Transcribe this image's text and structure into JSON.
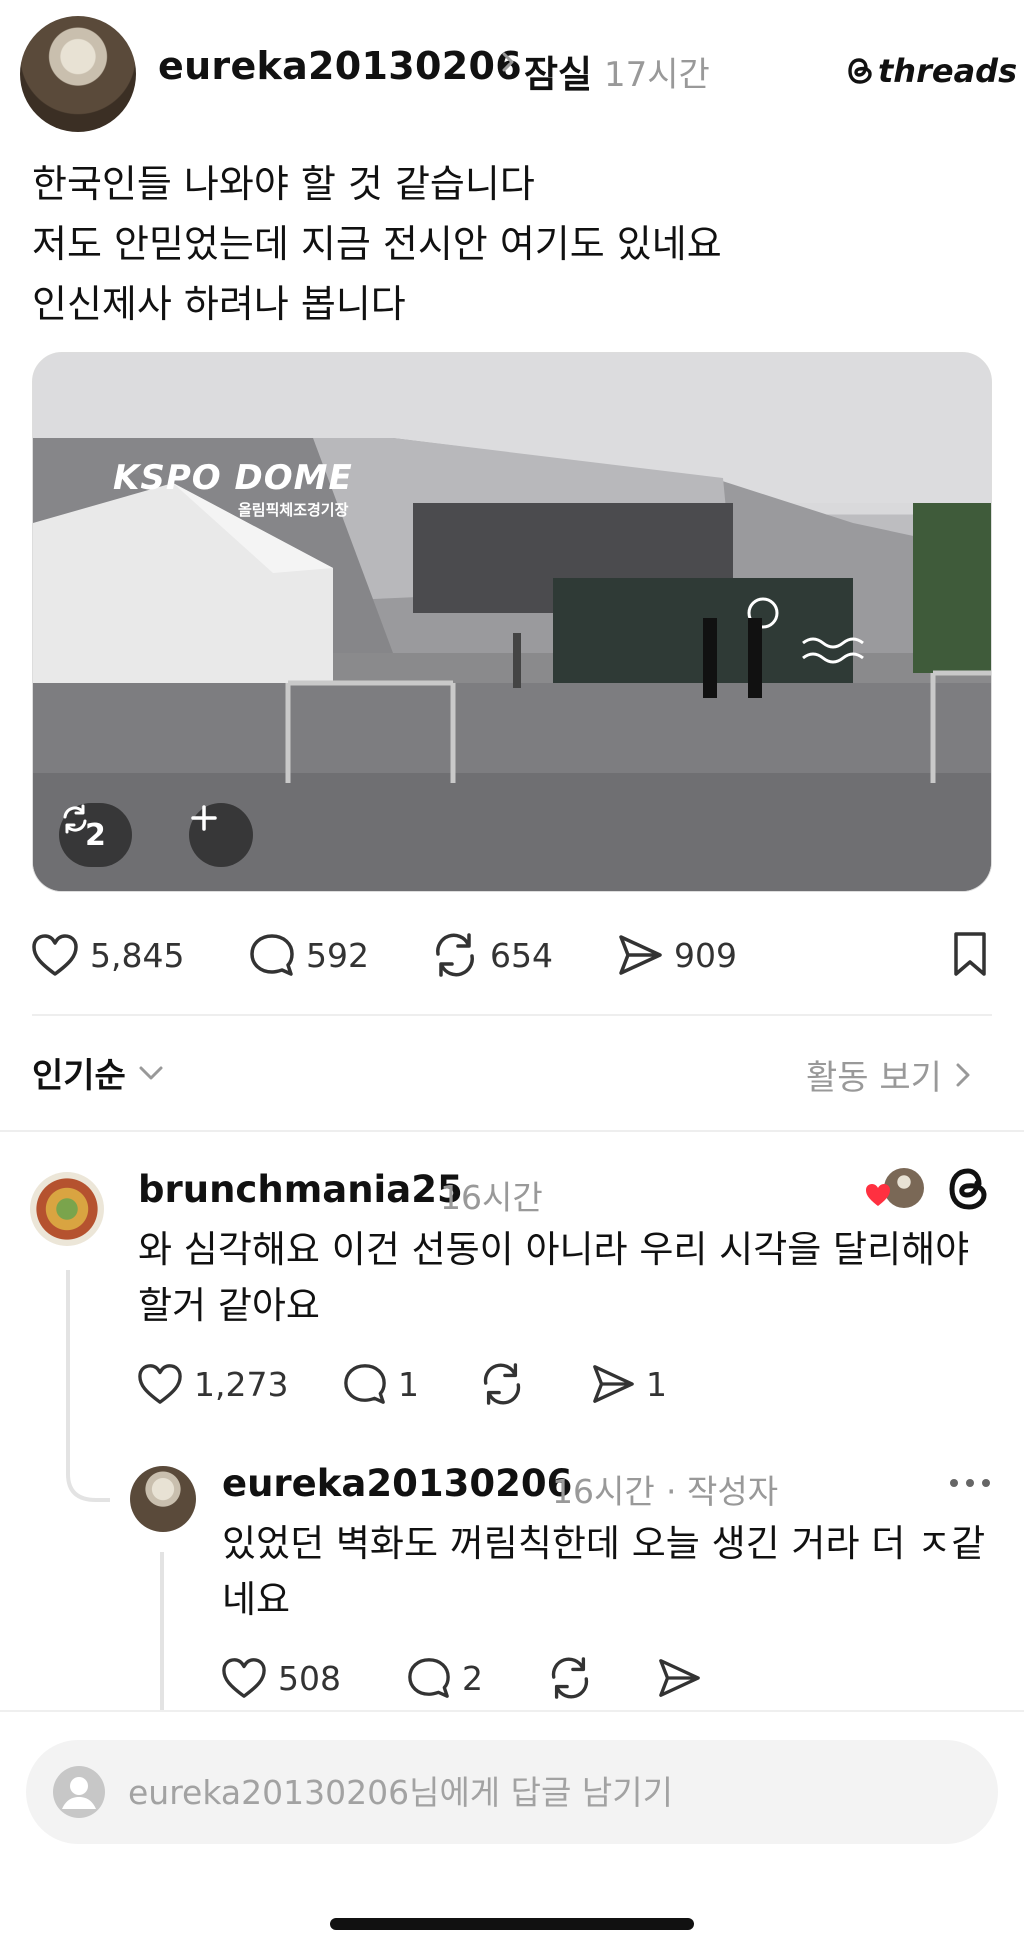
{
  "post": {
    "username": "eureka20130206",
    "location": "잠실",
    "time": "17시간",
    "brand": "threads",
    "text_lines": [
      "한국인들 나와야 할 것 같습니다",
      "저도 안믿었는데 지금 전시안 여기도 있네요",
      "인신제사 하려나 봅니다"
    ],
    "media": {
      "repost_count": "2",
      "sign_main": "KSPO DOME",
      "sign_sub": "올림픽체조경기장"
    },
    "stats": {
      "likes": "5,845",
      "replies": "592",
      "reposts": "654",
      "shares": "909"
    }
  },
  "sort": {
    "label": "인기순",
    "activity_label": "활동 보기"
  },
  "replies": [
    {
      "username": "brunchmania25",
      "time": "16시간",
      "text_lines": [
        "와 심각해요 이건 선동이 아니라 우리 시각을 달리해야",
        "할거 같아요"
      ],
      "likes": "1,273",
      "replies": "1",
      "shares": "1"
    },
    {
      "username": "eureka20130206",
      "time": "16시간",
      "author_badge": "· 작성자",
      "text_lines": [
        "있었던 벽화도 꺼림칙한데 오늘 생긴 거라 더 ㅈ같",
        "네요"
      ],
      "likes": "508",
      "replies": "2"
    }
  ],
  "compose": {
    "placeholder": "eureka20130206님에게 답글 남기기"
  },
  "colors": {
    "text": "#111111",
    "muted": "#999999",
    "heart_red": "#ff3040"
  }
}
